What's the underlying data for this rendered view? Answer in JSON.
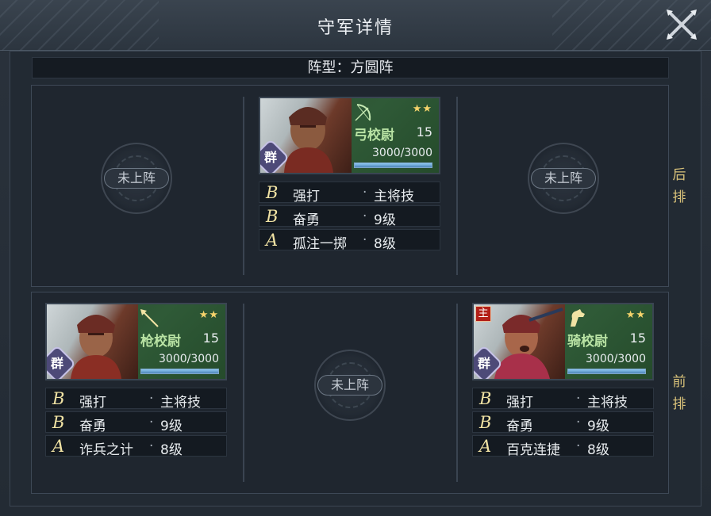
{
  "header": {
    "title": "守军详情"
  },
  "formation": {
    "label": "阵型：方圆阵"
  },
  "rows": {
    "back_label": "后排",
    "front_label": "前排"
  },
  "empty_slot_label": "未上阵",
  "units": [
    {
      "id": "archer",
      "name": "弓校尉",
      "level": "15",
      "stars": "★★",
      "hp_text": "3000/3000",
      "hp_fraction": 1.0,
      "faction": "群",
      "lord": "",
      "role_icon": "bow-icon",
      "skills": [
        {
          "grade": "B",
          "name": "强打",
          "value": "主将技"
        },
        {
          "grade": "B",
          "name": "奋勇",
          "value": "9级"
        },
        {
          "grade": "A",
          "name": "孤注一掷",
          "value": "8级"
        }
      ]
    },
    {
      "id": "spear",
      "name": "枪校尉",
      "level": "15",
      "stars": "★★",
      "hp_text": "3000/3000",
      "hp_fraction": 1.0,
      "faction": "群",
      "lord": "",
      "role_icon": "spear-icon",
      "skills": [
        {
          "grade": "B",
          "name": "强打",
          "value": "主将技"
        },
        {
          "grade": "B",
          "name": "奋勇",
          "value": "9级"
        },
        {
          "grade": "A",
          "name": "诈兵之计",
          "value": "8级"
        }
      ]
    },
    {
      "id": "cavalry",
      "name": "骑校尉",
      "level": "15",
      "stars": "★★",
      "hp_text": "3000/3000",
      "hp_fraction": 1.0,
      "faction": "群",
      "lord": "主",
      "role_icon": "horse-icon",
      "skills": [
        {
          "grade": "B",
          "name": "强打",
          "value": "主将技"
        },
        {
          "grade": "B",
          "name": "奋勇",
          "value": "9级"
        },
        {
          "grade": "A",
          "name": "百克连捷",
          "value": "8级"
        }
      ]
    }
  ],
  "colors": {
    "accent_gold": "#f1e3a4",
    "unit_name_green": "#b9e3a4",
    "faction_purple": "#4d4a78",
    "hp_blue": "#4d86b8"
  }
}
